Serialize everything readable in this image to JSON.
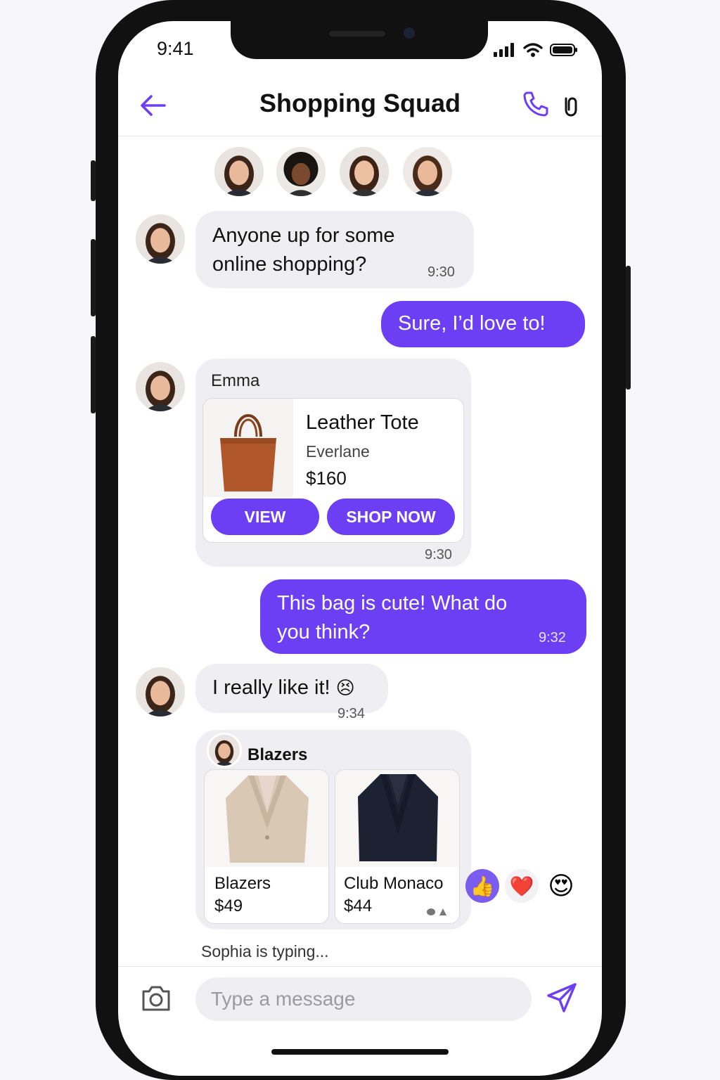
{
  "status": {
    "time": "9:41"
  },
  "header": {
    "title": "Shopping Squad"
  },
  "icons": {
    "back": "arrow-left-icon",
    "call": "phone-icon",
    "attach": "paperclip-icon",
    "camera": "camera-icon",
    "send": "send-icon"
  },
  "colors": {
    "accent": "#6c3ff5",
    "incoming_bubble": "#efeff3"
  },
  "messages": [
    {
      "type": "incoming",
      "text": "Anyone up for some online shopping?",
      "time": "9:30"
    },
    {
      "type": "outgoing",
      "text": "Sure, I’d love to!"
    },
    {
      "type": "incoming-product",
      "sender": "Emma",
      "product": {
        "name": "Leather Tote",
        "brand": "Everlane",
        "price": "$160"
      },
      "buttons": {
        "view": "VIEW",
        "shop": "SHOP NOW"
      },
      "time": "9:30"
    },
    {
      "type": "outgoing",
      "text": "This bag is cute! What do you think?",
      "time": "9:32"
    },
    {
      "type": "incoming",
      "text": "I really like it!",
      "emoji": "😣",
      "time": "9:34"
    },
    {
      "type": "incoming-collection",
      "title": "Blazers",
      "items": [
        {
          "name": "Blazers",
          "price": "$49"
        },
        {
          "name": "Club Monaco",
          "price": "$44"
        }
      ],
      "reactions": [
        "👍",
        "❤️",
        "😍"
      ]
    }
  ],
  "typing_indicator": "Sophia is typing...",
  "composer": {
    "placeholder": "Type a message"
  }
}
